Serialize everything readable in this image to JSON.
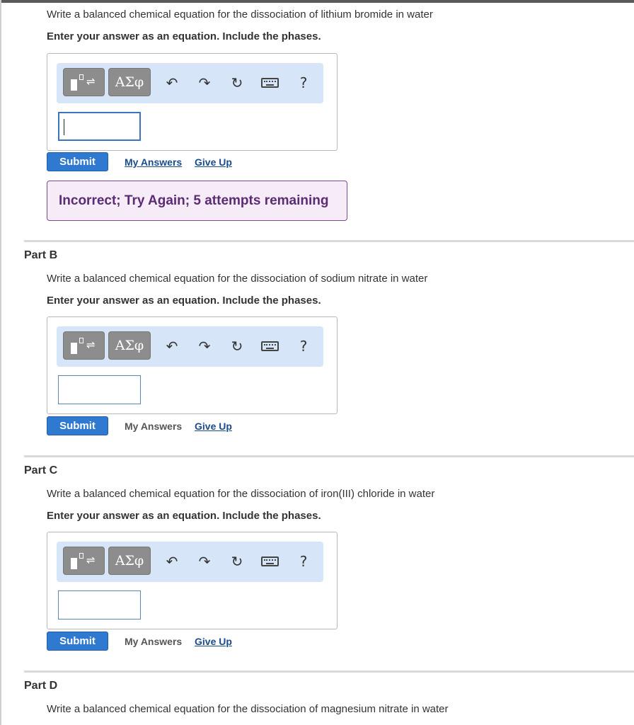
{
  "toolbar": {
    "template_icon": "template-icon",
    "greek_label": "ΑΣφ",
    "undo_icon": "undo-icon",
    "redo_icon": "redo-icon",
    "reset_icon": "reset-icon",
    "keyboard_icon": "keyboard-icon",
    "help_label": "?"
  },
  "actions": {
    "submit": "Submit",
    "my_answers": "My Answers",
    "give_up": "Give Up"
  },
  "part_a": {
    "question": "Write a balanced chemical equation for the dissociation of lithium bromide in water",
    "instruction": "Enter your answer as an equation. Include the phases.",
    "feedback": "Incorrect; Try Again; 5 attempts remaining"
  },
  "part_b": {
    "title": "Part B",
    "question": "Write a balanced chemical equation for the dissociation of sodium nitrate in water",
    "instruction": "Enter your answer as an equation. Include the phases."
  },
  "part_c": {
    "title": "Part C",
    "question": "Write a balanced chemical equation for the dissociation of iron(III) chloride in water",
    "instruction": "Enter your answer as an equation. Include the phases."
  },
  "part_d": {
    "title": "Part D",
    "question": "Write a balanced chemical equation for the dissociation of magnesium nitrate in water"
  },
  "colors": {
    "submit_blue": "#2f7ad0",
    "toolbar_bg": "#d6e6f8",
    "feedback_text": "#5b2b74",
    "feedback_bg": "#f5ecf8",
    "link": "#1a4b8c"
  }
}
